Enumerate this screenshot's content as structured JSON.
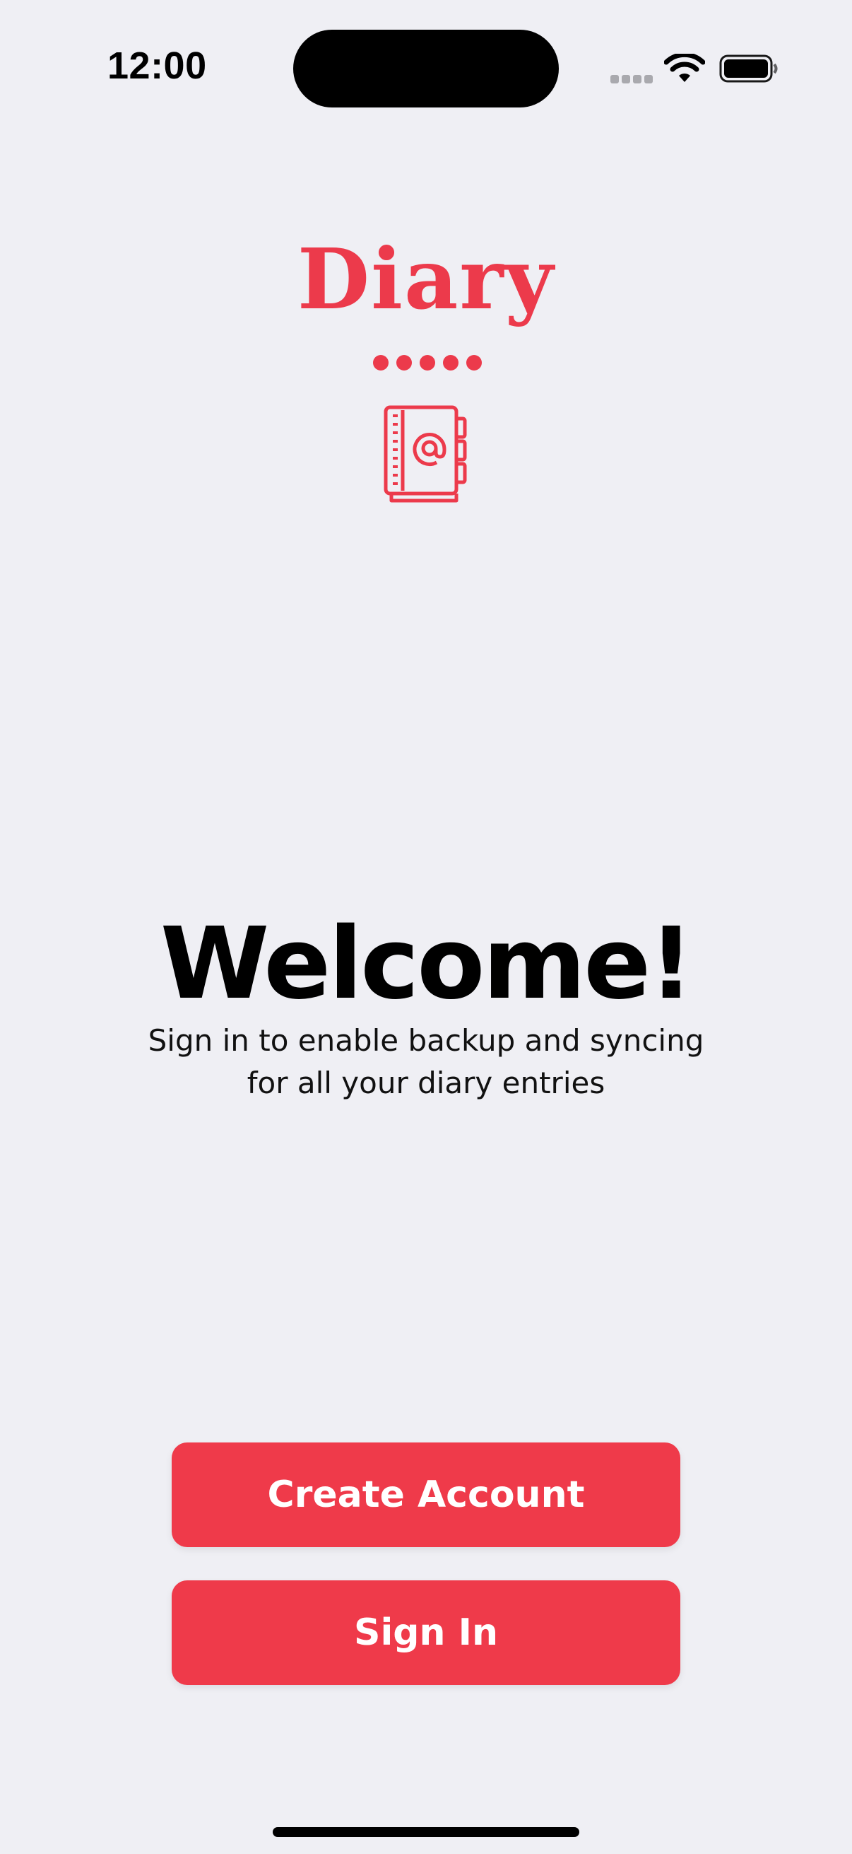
{
  "status_bar": {
    "time": "12:00",
    "icons": [
      "cellular-signal-icon",
      "wifi-icon",
      "battery-icon"
    ]
  },
  "logo": {
    "title": "Diary",
    "icon": "address-book-at-icon",
    "color": "#ec3a4b"
  },
  "welcome": {
    "heading": "Welcome!",
    "subtitle_line1": "Sign in to enable backup and syncing",
    "subtitle_line2": "for all your diary entries"
  },
  "actions": {
    "create_account_label": "Create Account",
    "sign_in_label": "Sign In",
    "button_color": "#ef3a4a"
  }
}
